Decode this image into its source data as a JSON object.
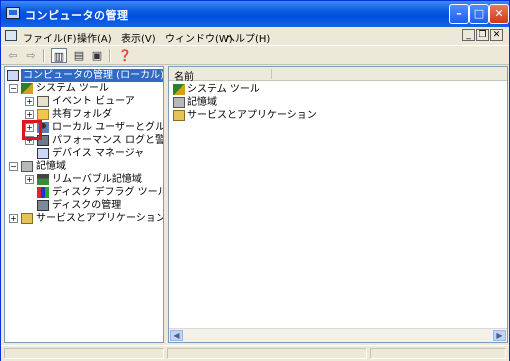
{
  "window": {
    "title": "コンピュータの管理"
  },
  "menubar": {
    "items": [
      "ファイル(F)",
      "操作(A)",
      "表示(V)",
      "ウィンドウ(W)",
      "ヘルプ(H)"
    ]
  },
  "tree": {
    "root": "コンピュータの管理 (ローカル)",
    "system_tools": "システム ツール",
    "event_viewer": "イベント ビューア",
    "shared_folders": "共有フォルダ",
    "local_users": "ローカル ユーザーとグループ",
    "perf_logs": "パフォーマンス ログと警告",
    "device_manager": "デバイス マネージャ",
    "storage": "記憶域",
    "removable": "リムーバブル記憶域",
    "defrag": "ディスク デフラグ ツール",
    "disk_mgmt": "ディスクの管理",
    "services_apps": "サービスとアプリケーション"
  },
  "list": {
    "column_name": "名前",
    "items": [
      "システム ツール",
      "記憶域",
      "サービスとアプリケーション"
    ]
  }
}
